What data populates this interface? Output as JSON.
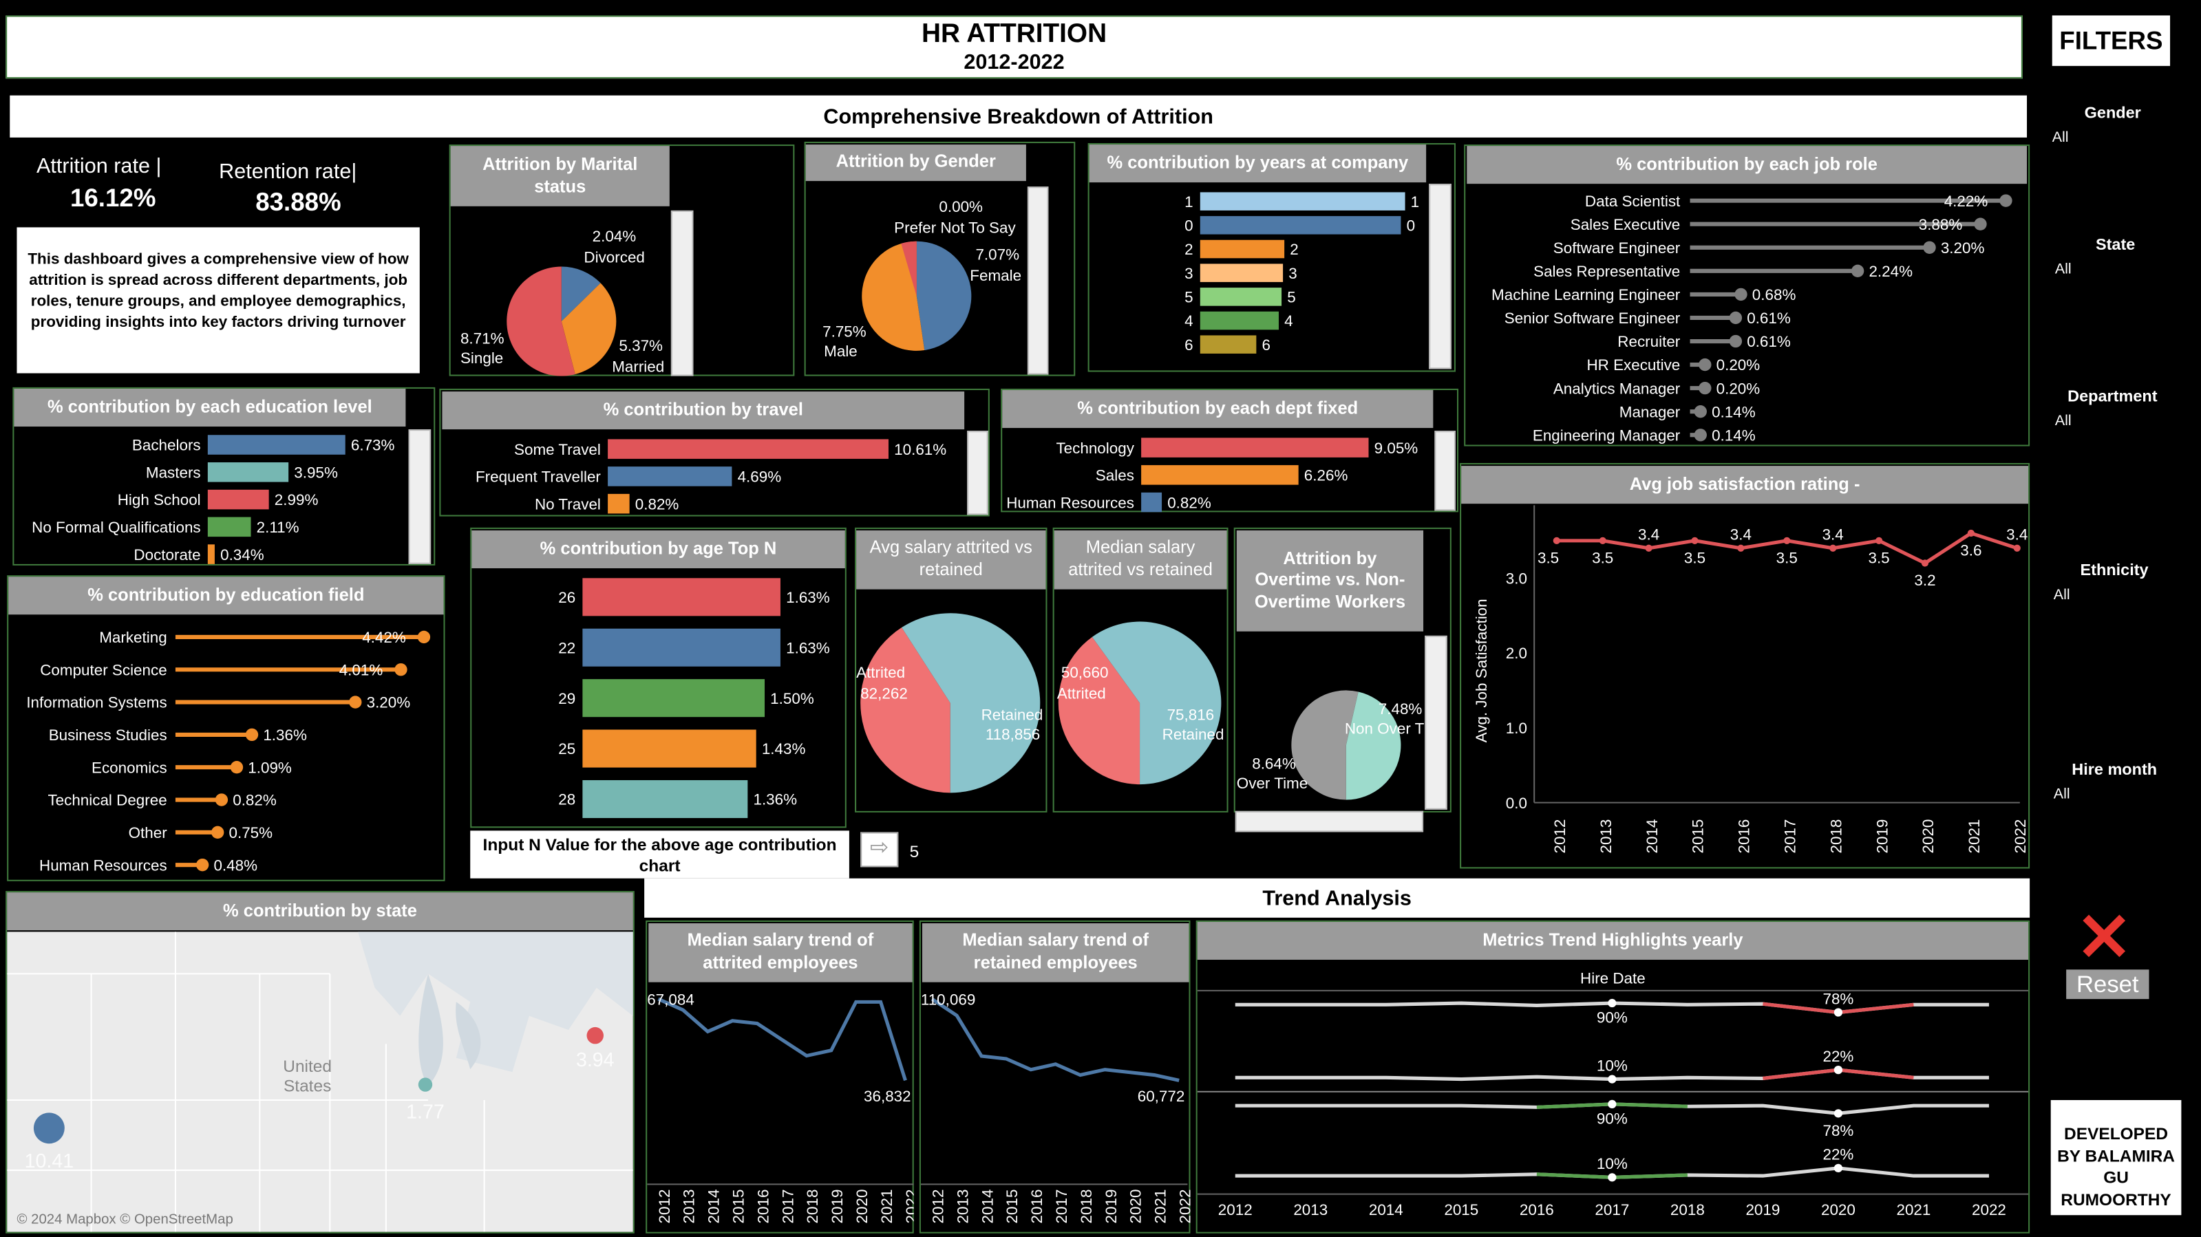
{
  "header": {
    "title": "HR ATTRITION",
    "subtitle": "2012-2022",
    "section_breakdown": "Comprehensive Breakdown of Attrition",
    "section_trend": "Trend Analysis"
  },
  "kpi": {
    "attrition_label": "Attrition rate |",
    "attrition_value": "16.12%",
    "retention_label": "Retention rate|",
    "retention_value": "83.88%",
    "description": "This dashboard gives a comprehensive view of how attrition is spread across different departments, job roles, tenure groups, and employee demographics, providing insights into key factors driving turnover"
  },
  "filters": {
    "title": "FILTERS",
    "items": [
      {
        "label": "Gender",
        "value": "All"
      },
      {
        "label": "State",
        "value": "All"
      },
      {
        "label": "Department",
        "value": "All"
      },
      {
        "label": "Ethnicity",
        "value": "All"
      },
      {
        "label": "Hire month",
        "value": "All"
      }
    ],
    "reset_label": "Reset",
    "developer": "DEVELOPED BY BALAMIRA GU RUMOORTHY"
  },
  "age_input": {
    "label": "Input N Value for the above age contribution chart",
    "value": "5"
  },
  "colors": {
    "red": "#e05559",
    "blue": "#4e79a7",
    "orange": "#f28e2b",
    "green": "#59a14f",
    "teal": "#76b7b2",
    "lightblue": "#a0cbe8",
    "peach": "#ffbe7d",
    "lightgreen": "#8cd17d",
    "gold": "#b6992d",
    "pie_red": "#f07273",
    "pie_teal": "#8ac4cc",
    "grey": "#9b9b9b",
    "lollipop_grey": "#7f7f7f"
  },
  "chart_data": [
    {
      "id": "marital",
      "type": "pie",
      "title": "Attrition by Marital status",
      "slices": [
        {
          "name": "Divorced",
          "value": 2.04,
          "label": "2.04%"
        },
        {
          "name": "Married",
          "value": 5.37,
          "label": "5.37%"
        },
        {
          "name": "Single",
          "value": 8.71,
          "label": "8.71%"
        }
      ]
    },
    {
      "id": "gender",
      "type": "pie",
      "title": "Attrition by Gender",
      "slices": [
        {
          "name": "Prefer Not To Say",
          "value": 0.0,
          "label": "0.00%"
        },
        {
          "name": "Female",
          "value": 7.07,
          "label": "7.07%"
        },
        {
          "name": "Male",
          "value": 7.75,
          "label": "7.75%"
        }
      ]
    },
    {
      "id": "years",
      "type": "bar",
      "title": "% contribution by years at company",
      "categories": [
        "1",
        "0",
        "2",
        "3",
        "5",
        "4",
        "6"
      ],
      "values": [
        1,
        0,
        2,
        3,
        5,
        4,
        6
      ],
      "labels": [
        "1",
        "0",
        "2",
        "3",
        "5",
        "4",
        "6"
      ]
    },
    {
      "id": "jobrole",
      "type": "bar",
      "title": "% contribution by each job role",
      "categories": [
        "Data Scientist",
        "Sales Executive",
        "Software Engineer",
        "Sales Representative",
        "Machine Learning Engineer",
        "Senior Software Engineer",
        "Recruiter",
        "HR Executive",
        "Analytics Manager",
        "Manager",
        "Engineering Manager"
      ],
      "values": [
        4.22,
        3.88,
        3.2,
        2.24,
        0.68,
        0.61,
        0.61,
        0.2,
        0.2,
        0.14,
        0.14
      ],
      "labels": [
        "4.22%",
        "3.88%",
        "3.20%",
        "2.24%",
        "0.68%",
        "0.61%",
        "0.61%",
        "0.20%",
        "0.20%",
        "0.14%",
        "0.14%"
      ]
    },
    {
      "id": "education",
      "type": "bar",
      "title": "% contribution by each education level",
      "categories": [
        "Bachelors",
        "Masters",
        "High School",
        "No Formal Qualifications",
        "Doctorate"
      ],
      "values": [
        6.73,
        3.95,
        2.99,
        2.11,
        0.34
      ],
      "labels": [
        "6.73%",
        "3.95%",
        "2.99%",
        "2.11%",
        "0.34%"
      ]
    },
    {
      "id": "travel",
      "type": "bar",
      "title": "% contribution by travel",
      "categories": [
        "Some Travel",
        "Frequent Traveller",
        "No Travel"
      ],
      "values": [
        10.61,
        4.69,
        0.82
      ],
      "labels": [
        "10.61%",
        "4.69%",
        "0.82%"
      ]
    },
    {
      "id": "dept",
      "type": "bar",
      "title": "% contribution by each dept fixed",
      "categories": [
        "Technology",
        "Sales",
        "Human Resources"
      ],
      "values": [
        9.05,
        6.26,
        0.82
      ],
      "labels": [
        "9.05%",
        "6.26%",
        "0.82%"
      ]
    },
    {
      "id": "satisfaction",
      "type": "line",
      "title": "Avg job satisfaction rating -",
      "ylabel": "Avg. Job Satisfaction",
      "x": [
        "2012",
        "2013",
        "2014",
        "2015",
        "2016",
        "2017",
        "2018",
        "2019",
        "2020",
        "2021",
        "2022"
      ],
      "values": [
        3.5,
        3.5,
        3.4,
        3.5,
        3.4,
        3.5,
        3.4,
        3.5,
        3.2,
        3.6,
        3.4
      ],
      "labels": [
        "3.5",
        "3.5",
        "3.4",
        "3.5",
        "3.4",
        "3.5",
        "3.4",
        "3.5",
        "3.2",
        "3.6",
        "3.4"
      ],
      "yticks": [
        "0.0",
        "1.0",
        "2.0",
        "3.0"
      ],
      "ylim": [
        0,
        3.6
      ]
    },
    {
      "id": "edufield",
      "type": "bar",
      "title": "% contribution by education field",
      "categories": [
        "Marketing",
        "Computer Science",
        "Information Systems",
        "Business Studies",
        "Economics",
        "Technical Degree",
        "Other",
        "Human Resources"
      ],
      "values": [
        4.42,
        4.01,
        3.2,
        1.36,
        1.09,
        0.82,
        0.75,
        0.48
      ],
      "labels": [
        "4.42%",
        "4.01%",
        "3.20%",
        "1.36%",
        "1.09%",
        "0.82%",
        "0.75%",
        "0.48%"
      ]
    },
    {
      "id": "age",
      "type": "bar",
      "title": "% contribution by age Top N",
      "categories": [
        "26",
        "22",
        "29",
        "25",
        "28"
      ],
      "values": [
        1.63,
        1.63,
        1.5,
        1.43,
        1.36
      ],
      "labels": [
        "1.63%",
        "1.63%",
        "1.50%",
        "1.43%",
        "1.36%"
      ]
    },
    {
      "id": "avgsalary",
      "type": "pie",
      "title": "Avg salary attrited vs retained",
      "slices": [
        {
          "name": "Attrited",
          "value": 82262,
          "label": "82,262"
        },
        {
          "name": "Retained",
          "value": 118856,
          "label": "118,856"
        }
      ]
    },
    {
      "id": "mediansalary",
      "type": "pie",
      "title": "Median salary attrited vs retained",
      "slices": [
        {
          "name": "Attrited",
          "value": 50660,
          "label": "50,660"
        },
        {
          "name": "Retained",
          "value": 75816,
          "label": "75,816"
        }
      ]
    },
    {
      "id": "overtime",
      "type": "pie",
      "title": "Attrition by Overtime vs. Non-Overtime Workers",
      "slices": [
        {
          "name": "Over Time",
          "value": 8.64,
          "label": "8.64%"
        },
        {
          "name": "Non Over T",
          "value": 7.48,
          "label": "7.48%"
        }
      ]
    },
    {
      "id": "state",
      "type": "scatter",
      "title": "% contribution by state",
      "points": [
        {
          "name": "CA",
          "value": 10.41,
          "label": "10.41"
        },
        {
          "name": "IL",
          "value": 1.77,
          "label": "1.77"
        },
        {
          "name": "NY",
          "value": 3.94,
          "label": "3.94"
        }
      ],
      "map_text": {
        "country": "United States",
        "attribution": "© 2024 Mapbox © OpenStreetMap"
      }
    },
    {
      "id": "attrited_trend",
      "type": "line",
      "title": "Median salary trend of attrited employees",
      "x": [
        "2012",
        "2013",
        "2014",
        "2015",
        "2016",
        "2017",
        "2018",
        "2019",
        "2020",
        "2021",
        "2022"
      ],
      "values": [
        67084,
        63000,
        55000,
        59000,
        58000,
        52000,
        46000,
        48000,
        66000,
        66000,
        36832
      ],
      "labels": {
        "first": "67,084",
        "last": "36,832"
      }
    },
    {
      "id": "retained_trend",
      "type": "line",
      "title": "Median salary trend of retained employees",
      "x": [
        "2012",
        "2013",
        "2014",
        "2015",
        "2016",
        "2017",
        "2018",
        "2019",
        "2020",
        "2021",
        "2022"
      ],
      "values": [
        110069,
        104000,
        89000,
        88000,
        84000,
        86000,
        82000,
        84000,
        83000,
        82000,
        80000
      ],
      "labels": {
        "first": "110,069",
        "last": "60,772"
      }
    },
    {
      "id": "metrics_trend",
      "type": "line",
      "title": "Metrics Trend Highlights yearly",
      "xlabel": "Hire Date",
      "x": [
        "2012",
        "2013",
        "2014",
        "2015",
        "2016",
        "2017",
        "2018",
        "2019",
        "2020",
        "2021",
        "2022"
      ],
      "series": [
        {
          "values": [
            88,
            88,
            88,
            90,
            87,
            90,
            88,
            89,
            78,
            88,
            88
          ],
          "labels": [
            {
              "i": 5,
              "text": "90%"
            },
            {
              "i": 8,
              "text": "78%"
            }
          ],
          "highlight": {
            "from": 7,
            "to": 9,
            "color": "#e05559"
          }
        },
        {
          "values": [
            12,
            12,
            12,
            10,
            13,
            10,
            12,
            11,
            22,
            12,
            12
          ],
          "labels": [
            {
              "i": 5,
              "text": "10%"
            },
            {
              "i": 8,
              "text": "22%"
            }
          ],
          "highlight": {
            "from": 7,
            "to": 9,
            "color": "#e05559"
          }
        },
        {
          "values": [
            88,
            88,
            88,
            88,
            86,
            90,
            87,
            88,
            78,
            88,
            88
          ],
          "labels": [
            {
              "i": 5,
              "text": "90%"
            },
            {
              "i": 8,
              "text": "78%"
            }
          ],
          "highlight": {
            "from": 4,
            "to": 6,
            "color": "#59a14f"
          }
        },
        {
          "values": [
            12,
            12,
            12,
            12,
            14,
            10,
            13,
            12,
            22,
            12,
            12
          ],
          "labels": [
            {
              "i": 5,
              "text": "10%"
            },
            {
              "i": 8,
              "text": "22%"
            }
          ],
          "highlight": {
            "from": 4,
            "to": 6,
            "color": "#59a14f"
          }
        }
      ]
    }
  ]
}
